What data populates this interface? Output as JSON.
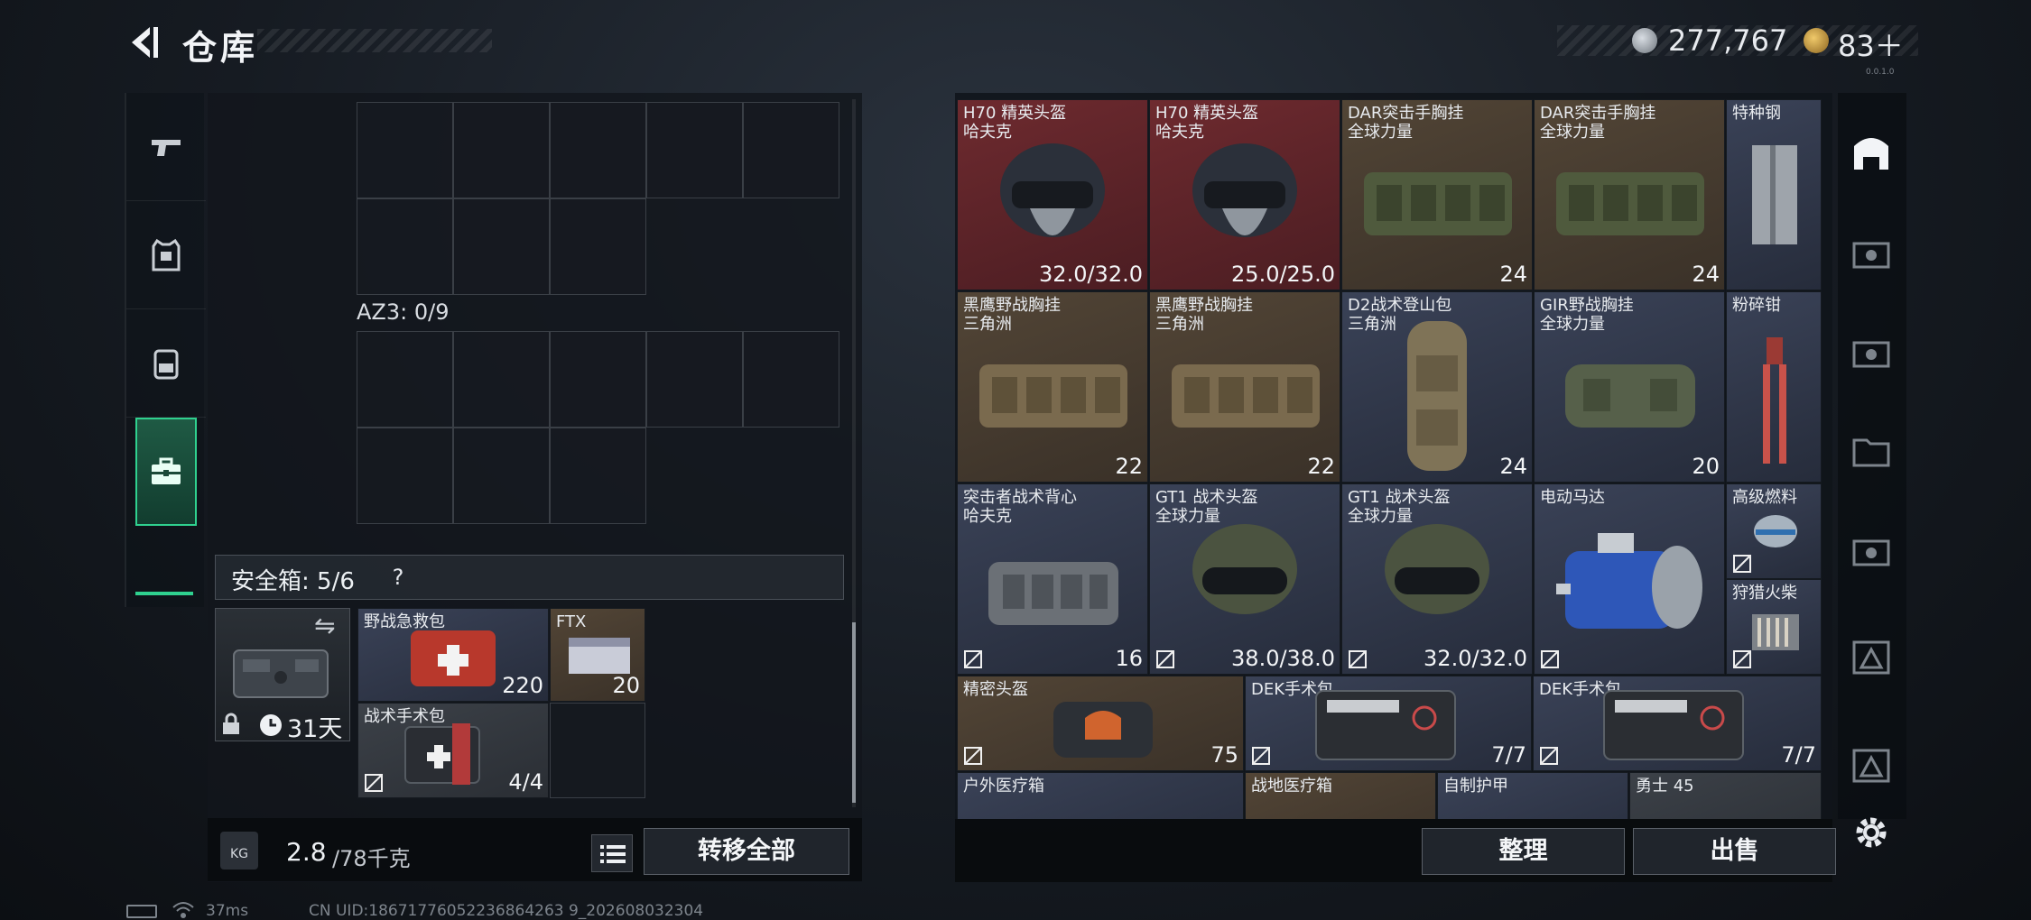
{
  "header": {
    "title": "仓库",
    "currency_coin": "277,767",
    "currency_gold": "83＋",
    "version": "0.0.1.0"
  },
  "backpack": {
    "az3_label": "AZ3: 0/9",
    "safe_label": "安全箱: 5/6",
    "safe_help": "?",
    "safebox_days": "31天",
    "safe_items": [
      {
        "name": "野战急救包",
        "qty": "220"
      },
      {
        "name": "FTX",
        "qty": "20"
      },
      {
        "name": "战术手术包",
        "qty": "4/4"
      }
    ],
    "weight_current": "2.8",
    "weight_max": "/78千克",
    "transfer_label": "转移全部",
    "kg_label": "KG"
  },
  "warehouse": {
    "items": [
      {
        "name": "H70 精英头盔",
        "brand": "哈夫克",
        "qty": "32.0/32.0"
      },
      {
        "name": "H70 精英头盔",
        "brand": "哈夫克",
        "qty": "25.0/25.0"
      },
      {
        "name": "DAR突击手胸挂",
        "brand": "全球力量",
        "qty": "24"
      },
      {
        "name": "DAR突击手胸挂",
        "brand": "全球力量",
        "qty": "24"
      },
      {
        "name": "特种钢",
        "brand": "",
        "qty": ""
      },
      {
        "name": "黑鹰野战胸挂",
        "brand": "三角洲",
        "qty": "22"
      },
      {
        "name": "黑鹰野战胸挂",
        "brand": "三角洲",
        "qty": "22"
      },
      {
        "name": "D2战术登山包",
        "brand": "三角洲",
        "qty": "24"
      },
      {
        "name": "GIR野战胸挂",
        "brand": "全球力量",
        "qty": "20"
      },
      {
        "name": "粉碎钳",
        "brand": "",
        "qty": ""
      },
      {
        "name": "突击者战术背心",
        "brand": "哈夫克",
        "qty": "16"
      },
      {
        "name": "GT1 战术头盔",
        "brand": "全球力量",
        "qty": "38.0/38.0"
      },
      {
        "name": "GT1 战术头盔",
        "brand": "全球力量",
        "qty": "32.0/32.0"
      },
      {
        "name": "电动马达",
        "brand": "",
        "qty": ""
      },
      {
        "name": "高级燃料",
        "brand": "",
        "qty": ""
      },
      {
        "name": "狩猎火柴",
        "brand": "",
        "qty": ""
      },
      {
        "name": "精密头盔",
        "brand": "",
        "qty": "75"
      },
      {
        "name": "DEK手术包",
        "brand": "",
        "qty": "7/7"
      },
      {
        "name": "DEK手术包",
        "brand": "",
        "qty": "7/7"
      },
      {
        "name": "户外医疗箱",
        "brand": "",
        "qty": ""
      },
      {
        "name": "战地医疗箱",
        "brand": "",
        "qty": ""
      },
      {
        "name": "自制护甲",
        "brand": "",
        "qty": ""
      },
      {
        "name": "勇士 45",
        "brand": "",
        "qty": ""
      }
    ],
    "sort_label": "整理",
    "sell_label": "出售"
  },
  "status": {
    "ping": "37ms",
    "uid": "CN UID:18671776052236864263 9_202608032304"
  },
  "colors": {
    "accent": "#2fd18f",
    "rare_red": "#6e2a2f",
    "rare_brown": "#524536",
    "rare_blue": "#3a4257"
  },
  "icons": [
    "back-arrow-icon",
    "pistol-icon",
    "armor-vest-icon",
    "backpack-icon",
    "case-icon",
    "helmet-filter-icon",
    "settings-icon",
    "lock-icon",
    "clock-icon",
    "swap-icon",
    "list-icon"
  ]
}
